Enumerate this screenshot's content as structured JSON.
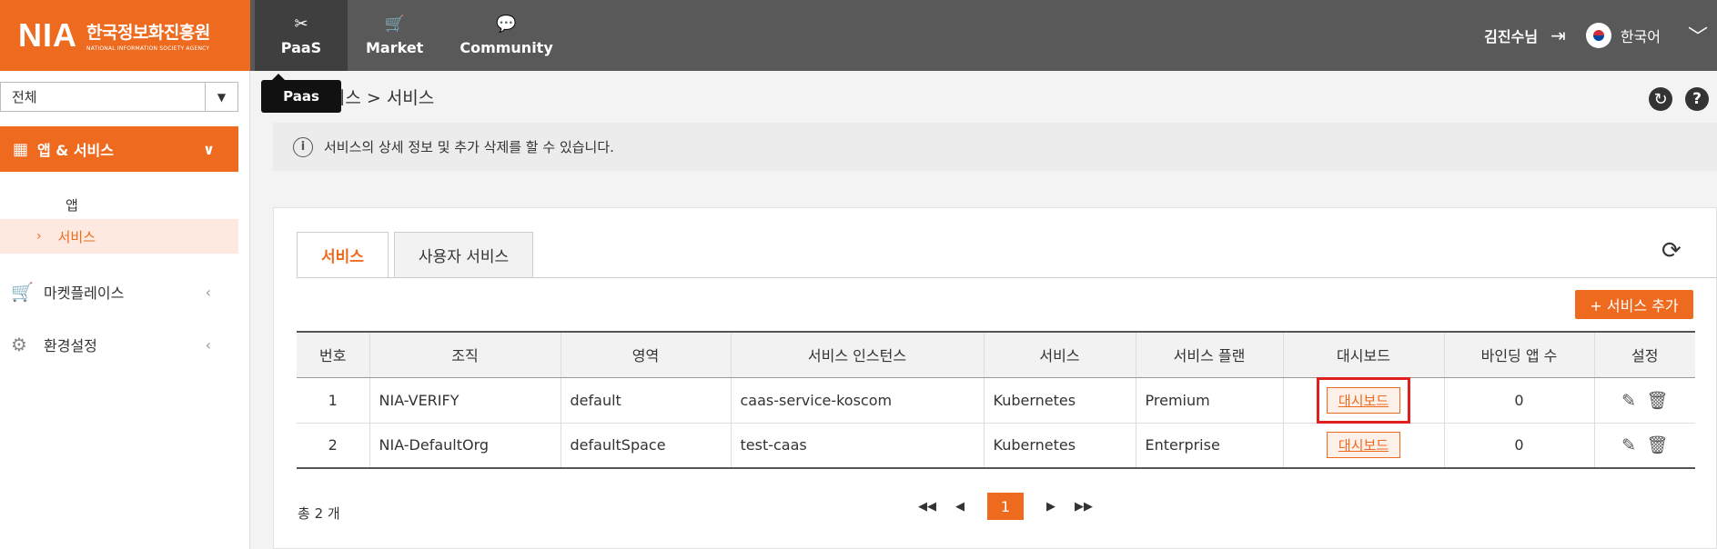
{
  "header": {
    "logo": {
      "mark": "NIA",
      "name_kr": "한국정보화진흥원",
      "name_en": "NATIONAL INFORMATION SOCIETY AGENCY"
    },
    "nav": [
      {
        "label": "PaaS",
        "icon": "tools-icon"
      },
      {
        "label": "Market",
        "icon": "cart-icon"
      },
      {
        "label": "Community",
        "icon": "chat-icon"
      }
    ],
    "user_name": "김진수님",
    "language": "한국어"
  },
  "tooltip": "Paas",
  "sidebar": {
    "select_value": "전체",
    "menu_app": "앱 & 서비스",
    "sub_app": "앱",
    "sub_service": "서비스",
    "menu_market": "마켓플레이스",
    "menu_env": "환경설정"
  },
  "content": {
    "breadcrumb": "앱 & 서비스 > 서비스",
    "info": "서비스의 상세 정보 및 추가 삭제를 할 수 있습니다.",
    "tabs": [
      "서비스",
      "사용자 서비스"
    ],
    "add_button": "+ 서비스 추가",
    "columns": [
      "번호",
      "조직",
      "영역",
      "서비스 인스턴스",
      "서비스",
      "서비스 플랜",
      "대시보드",
      "바인딩 앱 수",
      "설정"
    ],
    "rows": [
      {
        "no": "1",
        "org": "NIA-VERIFY",
        "space": "default",
        "instance": "caas-service-koscom",
        "service": "Kubernetes",
        "plan": "Premium",
        "dashboard": "대시보드",
        "bindings": "0"
      },
      {
        "no": "2",
        "org": "NIA-DefaultOrg",
        "space": "defaultSpace",
        "instance": "test-caas",
        "service": "Kubernetes",
        "plan": "Enterprise",
        "dashboard": "대시보드",
        "bindings": "0"
      }
    ],
    "total": "총 2 개",
    "current_page": "1"
  },
  "colors": {
    "accent": "#ee6a1f",
    "topbar": "#595959",
    "highlight": "#e0201e"
  }
}
